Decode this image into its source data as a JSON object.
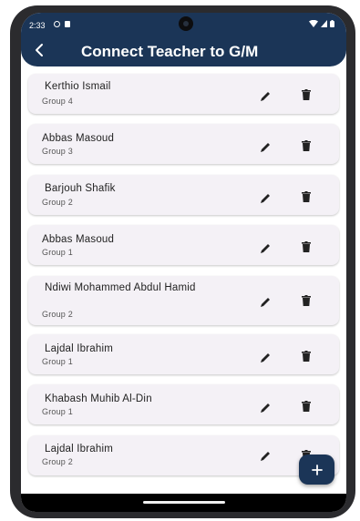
{
  "status": {
    "time": "2:33"
  },
  "header": {
    "title": "Connect Teacher to G/M"
  },
  "items": [
    {
      "name": "Kerthio Ismail",
      "group": "Group 4"
    },
    {
      "name": "Abbas Masoud",
      "group": "Group 3"
    },
    {
      "name": "Barjouh Shafik",
      "group": "Group 2"
    },
    {
      "name": "Abbas Masoud",
      "group": "Group 1"
    },
    {
      "name": "Ndiwi Mohammed Abdul Hamid",
      "group": "Group 2"
    },
    {
      "name": "Lajdal Ibrahim",
      "group": "Group 1"
    },
    {
      "name": "Khabash Muhib Al-Din",
      "group": "Group 1"
    },
    {
      "name": "Lajdal Ibrahim",
      "group": "Group 2"
    }
  ],
  "fab": {
    "label": "+"
  },
  "colors": {
    "primary": "#1b3557",
    "card": "#f4f1f6"
  }
}
